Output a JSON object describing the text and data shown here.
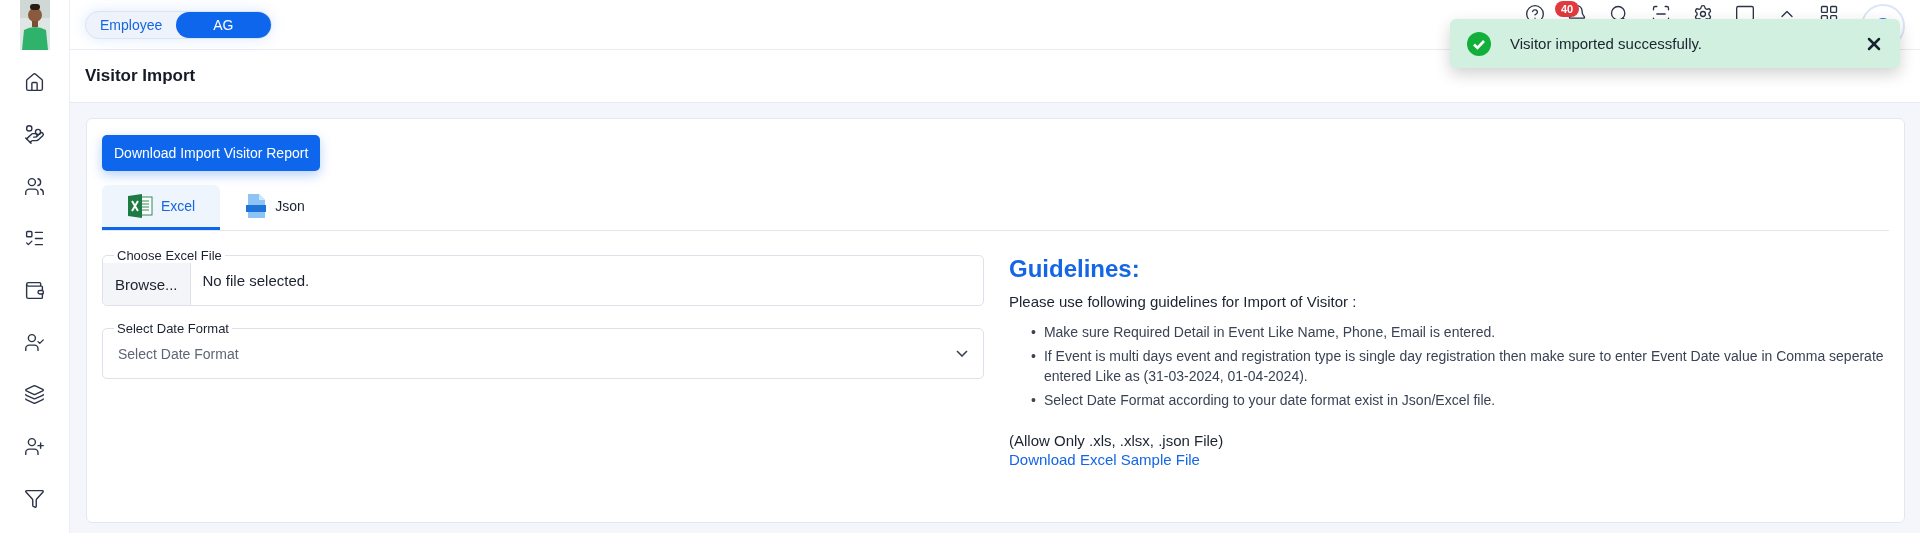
{
  "header": {
    "mode_toggle": [
      {
        "label": "Employee",
        "selected": false
      },
      {
        "label": "AG",
        "selected": true
      }
    ],
    "notification_badge": "40"
  },
  "page_title": "Visitor Import",
  "toast": {
    "kind": "success",
    "message": "Visitor imported successfully."
  },
  "download_button": "Download Import Visitor Report",
  "tabs": [
    {
      "kind": "excel",
      "label": "Excel",
      "selected": true
    },
    {
      "kind": "json",
      "label": "Json",
      "selected": false
    }
  ],
  "file_field": {
    "label": "Choose Excel File",
    "button": "Browse...",
    "value": "No file selected."
  },
  "date_format_field": {
    "label": "Select Date Format",
    "placeholder": "Select Date Format"
  },
  "guidelines": {
    "title": "Guidelines:",
    "intro": "Please use following guidelines for Import of Visitor :",
    "items": [
      {
        "bullet": "•",
        "text": "Make sure Required Detail in Event Like Name, Phone, Email is entered."
      },
      {
        "bullet": "•",
        "text": "If Event is multi days event and registration type is single day registration then make sure to enter Event Date value in Comma seperate entered Like as (31-03-2024, 01-04-2024)."
      },
      {
        "bullet": "•",
        "text": "Select Date Format according to your date format exist in Json/Excel file."
      }
    ],
    "note": "(Allow Only .xls, .xlsx, .json File)",
    "link": "Download Excel Sample File"
  }
}
